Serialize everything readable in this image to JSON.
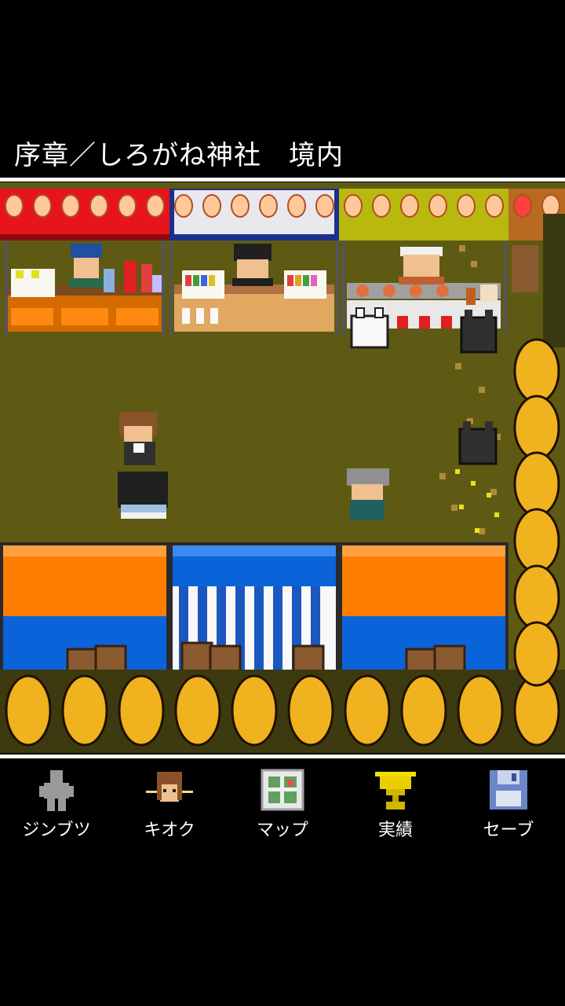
{
  "location_title": "序章／しろがね神社　境内",
  "menu": {
    "items": [
      {
        "label": "ジンブツ",
        "icon": "person-silhouette-icon"
      },
      {
        "label": "キオク",
        "icon": "memory-portrait-icon"
      },
      {
        "label": "マップ",
        "icon": "map-icon"
      },
      {
        "label": "実績",
        "icon": "trophy-icon"
      },
      {
        "label": "セーブ",
        "icon": "floppy-disk-icon"
      }
    ]
  },
  "colors": {
    "grass": "#5e5a14",
    "stall_red": "#e8141c",
    "stall_navy": "#1c2f8c",
    "stall_yellow": "#b9b80e",
    "tree_gold": "#f0b21e",
    "awning_orange": "#ff7e00",
    "awning_blue": "#0a63d8"
  }
}
